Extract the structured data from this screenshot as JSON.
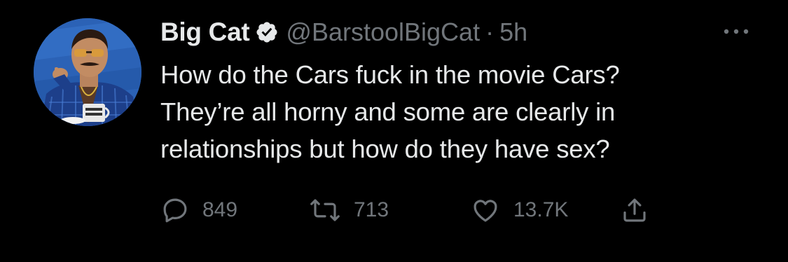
{
  "tweet": {
    "display_name": "Big Cat",
    "handle": "@BarstoolBigCat",
    "separator": "·",
    "time": "5h",
    "text_lines": [
      "How do the Cars fuck in the movie Cars?",
      "They’re all horny and some are clearly in",
      "relationships but how do they have sex?"
    ]
  },
  "actions": {
    "reply_count": "849",
    "retweet_count": "713",
    "like_count": "13.7K"
  },
  "colors": {
    "background": "#000000",
    "primary_text": "#e7e9ea",
    "secondary_text": "#71767b",
    "verified_badge": "#e7e9ea"
  },
  "icons": {
    "verified": "verified-badge-icon",
    "more": "more-options-icon",
    "reply": "reply-icon",
    "retweet": "retweet-icon",
    "like": "heart-icon",
    "share": "share-icon"
  }
}
